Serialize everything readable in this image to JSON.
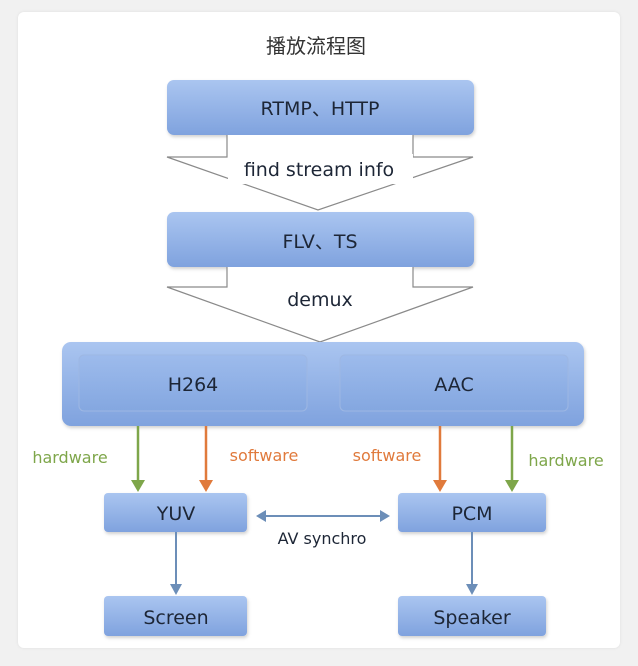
{
  "diagram": {
    "title": "播放流程图",
    "nodes": {
      "source": "RTMP、HTTP",
      "container": "FLV、TS",
      "video_codec": "H264",
      "audio_codec": "AAC",
      "video_raw": "YUV",
      "audio_raw": "PCM",
      "video_out": "Screen",
      "audio_out": "Speaker"
    },
    "steps": {
      "probe": "find stream info",
      "demux": "demux"
    },
    "edges": {
      "hw_left": "hardware",
      "sw_left": "software",
      "sw_right": "software",
      "hw_right": "hardware",
      "sync": "AV synchro"
    },
    "colors": {
      "box_fill_top": "#a7c2ef",
      "box_fill_bottom": "#7fa3df",
      "box_border": "#8fb0e6",
      "hardware": "#7ea64a",
      "software": "#e07a3c",
      "flow_arrow": "#6c8eb8",
      "label_text": "#1d2636"
    }
  }
}
